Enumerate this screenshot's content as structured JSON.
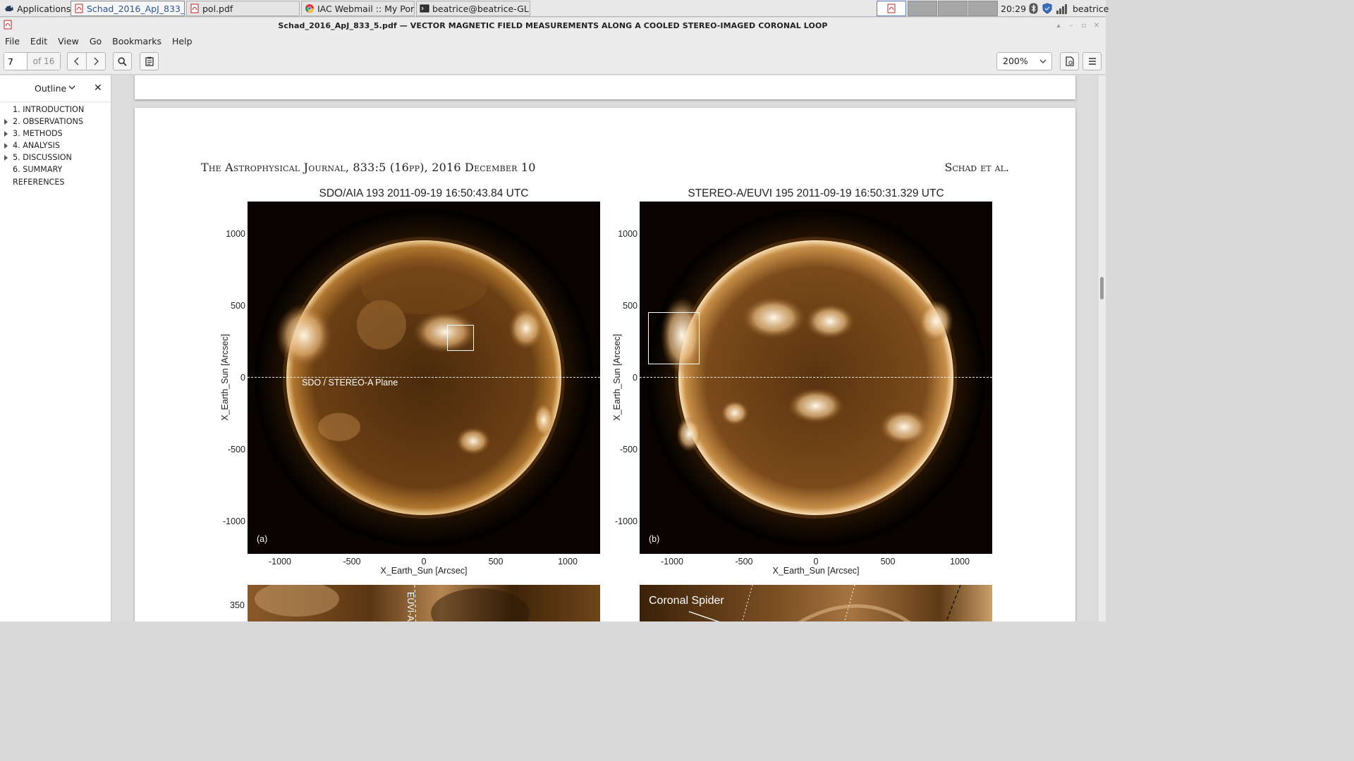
{
  "taskbar": {
    "apps_label": "Applications",
    "tasks": [
      {
        "label": "Schad_2016_ApJ_833_5...",
        "active": true
      },
      {
        "label": "pol.pdf",
        "active": false
      },
      {
        "label": "IAC Webmail :: My Porta...",
        "active": false
      },
      {
        "label": "beatrice@beatrice-GL55...",
        "active": false
      }
    ],
    "clock": "20:29",
    "user": "beatrice"
  },
  "window": {
    "title": "Schad_2016_ApJ_833_5.pdf — VECTOR MAGNETIC FIELD MEASUREMENTS ALONG A COOLED STEREO-IMAGED CORONAL LOOP"
  },
  "menu": [
    "File",
    "Edit",
    "View",
    "Go",
    "Bookmarks",
    "Help"
  ],
  "toolbar": {
    "page_value": "7",
    "page_of": "of 16",
    "zoom": "200%"
  },
  "sidebar": {
    "header": "Outline",
    "items": [
      {
        "label": "1. INTRODUCTION",
        "expandable": false
      },
      {
        "label": "2. OBSERVATIONS",
        "expandable": true
      },
      {
        "label": "3. METHODS",
        "expandable": true
      },
      {
        "label": "4. ANALYSIS",
        "expandable": true
      },
      {
        "label": "5. DISCUSSION",
        "expandable": true
      },
      {
        "label": "6. SUMMARY",
        "expandable": false
      },
      {
        "label": "REFERENCES",
        "expandable": false
      }
    ]
  },
  "page": {
    "journal_header": "The Astrophysical Journal, 833:5 (16pp), 2016 December 10",
    "author_header": "Schad et al.",
    "panel_a": {
      "title": "SDO/AIA 193 2011-09-19 16:50:43.84 UTC",
      "label": "(a)",
      "plane_label": "SDO / STEREO-A Plane",
      "xlabel": "X_Earth_Sun [Arcsec]",
      "ylabel": "X_Earth_Sun [Arcsec]"
    },
    "panel_b": {
      "title": "STEREO-A/EUVI 195 2011-09-19 16:50:31.329 UTC",
      "label": "(b)",
      "xlabel": "X_Earth_Sun [Arcsec]",
      "ylabel": "X_Earth_Sun [Arcsec]"
    },
    "x_ticks": [
      "-1000",
      "-500",
      "0",
      "500",
      "1000"
    ],
    "y_ticks": [
      "1000",
      "500",
      "0",
      "-500",
      "-1000"
    ],
    "lower_panel_tick": "350",
    "lower_left_label": "EUVI-A",
    "lower_right_label": "Coronal Spider"
  },
  "colors": {
    "accent": "#2a5599",
    "sun_core": "#5b3410",
    "sun_bright": "#fff1d6"
  }
}
